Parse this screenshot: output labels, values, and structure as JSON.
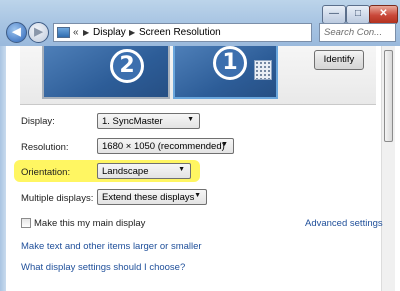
{
  "window": {
    "controls": {
      "minimize": "—",
      "maximize": "□",
      "close": "✕"
    },
    "nav": {
      "back": "◀",
      "forward": "▶"
    }
  },
  "address_bar": {
    "prefix": "«",
    "segments": [
      "Display",
      "Screen Resolution"
    ],
    "separator": "▶"
  },
  "search": {
    "placeholder": "Search Con..."
  },
  "preview": {
    "monitors": [
      {
        "number": "2",
        "selected": false
      },
      {
        "number": "1",
        "selected": true
      }
    ],
    "identify_label": "Identify"
  },
  "settings": {
    "display": {
      "label": "Display:",
      "value": "1. SyncMaster"
    },
    "resolution": {
      "label": "Resolution:",
      "value": "1680 × 1050 (recommended)"
    },
    "orientation": {
      "label": "Orientation:",
      "value": "Landscape"
    },
    "multiple": {
      "label": "Multiple displays:",
      "value": "Extend these displays"
    }
  },
  "main_display": {
    "label": "Make this my main display",
    "checked": false
  },
  "links": {
    "advanced": "Advanced settings",
    "text_size": "Make text and other items larger or smaller",
    "help": "What display settings should I choose?"
  },
  "colors": {
    "highlight": "#fff546",
    "link": "#1f4f9a",
    "monitor": "#3c6fae"
  }
}
